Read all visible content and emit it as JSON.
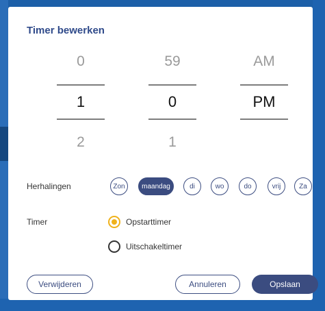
{
  "dialog": {
    "title": "Timer bewerken"
  },
  "picker": {
    "hour": {
      "prev": "0",
      "current": "1",
      "next": "2"
    },
    "minute": {
      "prev": "59",
      "current": "0",
      "next": "1"
    },
    "ampm": {
      "prev": "AM",
      "current": "PM"
    }
  },
  "repeat": {
    "label": "Herhalingen",
    "days": [
      {
        "label": "Zon",
        "selected": false
      },
      {
        "label": "maandag",
        "selected": true
      },
      {
        "label": "di",
        "selected": false
      },
      {
        "label": "wo",
        "selected": false
      },
      {
        "label": "do",
        "selected": false
      },
      {
        "label": "vrij",
        "selected": false
      },
      {
        "label": "Za",
        "selected": false
      }
    ]
  },
  "timer": {
    "label": "Timer",
    "options": [
      {
        "label": "Opstarttimer",
        "checked": true
      },
      {
        "label": "Uitschakeltimer",
        "checked": false
      }
    ]
  },
  "buttons": {
    "delete": "Verwijderen",
    "cancel": "Annuleren",
    "save": "Opslaan"
  },
  "colors": {
    "accent": "#3b4c80",
    "radio_selected": "#f0b21c",
    "background": "#1c5fa8"
  }
}
